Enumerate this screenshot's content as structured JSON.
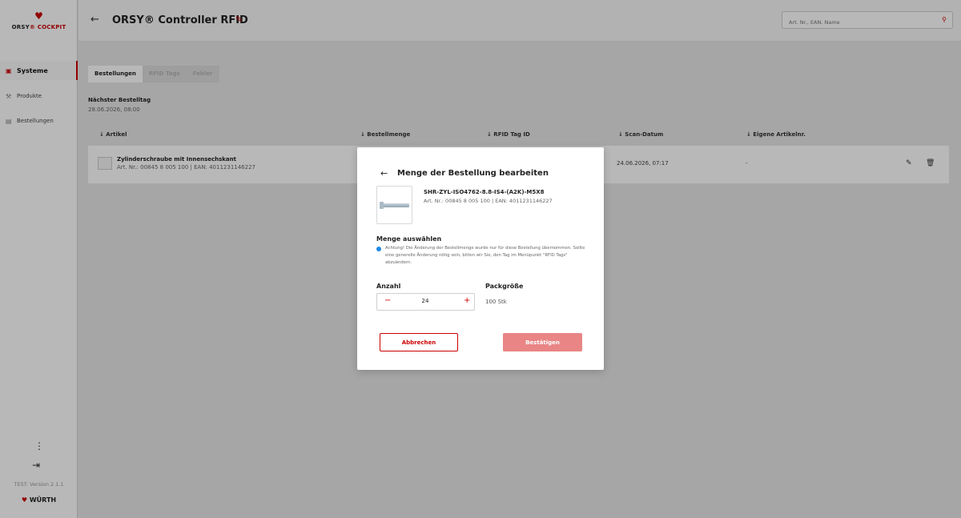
{
  "sidebar": {
    "logo_mark": "♥",
    "logo_text_a": "ORSY",
    "logo_text_b": "® COCKPIT",
    "items": [
      {
        "label": "Systeme",
        "icon": "box-icon"
      },
      {
        "label": "Produkte",
        "icon": "wrench-icon"
      },
      {
        "label": "Bestellungen",
        "icon": "cart-icon"
      }
    ],
    "version": "TEST: Version 2.1.1",
    "brand": "WÜRTH",
    "brand_mark": "♥"
  },
  "header": {
    "title": "ORSY® Controller RFID",
    "search_placeholder": "Art. Nr., EAN, Name"
  },
  "tabs": [
    "Bestellungen",
    "RFID Tags",
    "Fehler"
  ],
  "next_order": {
    "label": "Nächster Bestelltag",
    "value": "28.06.2026, 08:00"
  },
  "table": {
    "headers": [
      "↓ Artikel",
      "↓ Bestellmenge",
      "↓ RFID Tag ID",
      "↓ Scan-Datum",
      "↓ Eigene Artikelnr."
    ],
    "rows": [
      {
        "name": "Zylinderschraube mit Innensechskant",
        "sub": "Art. Nr.: 00845 8 005 100 | EAN: 4011231146227",
        "scan_date": "24.06.2026, 07:17",
        "own_nr": "-"
      }
    ]
  },
  "modal": {
    "title": "Menge der Bestellung bearbeiten",
    "sku": "SHR-ZYL-ISO4762-8.8-IS4-(A2K)-M5X8",
    "art": "Art. Nr.: 00845 8 005 100 | EAN: 4011231146227",
    "section": "Menge auswählen",
    "note": "Achtung! Die Änderung der Bestellmenge wurde nur für diese Bestellung übernommen. Sollte eine generelle Änderung nötig sein, bitten wir Sie, den Tag im Menüpunkt \"RFID Tags\" abzuändern.",
    "qty_label": "Anzahl",
    "qty_value": "24",
    "pack_label": "Packgröße",
    "pack_value": "100 Stk",
    "cancel": "Abbrechen",
    "confirm": "Bestätigen"
  },
  "colors": {
    "accent": "#cc0000",
    "confirm_disabled": "#e98585",
    "info": "#1e88e5"
  }
}
